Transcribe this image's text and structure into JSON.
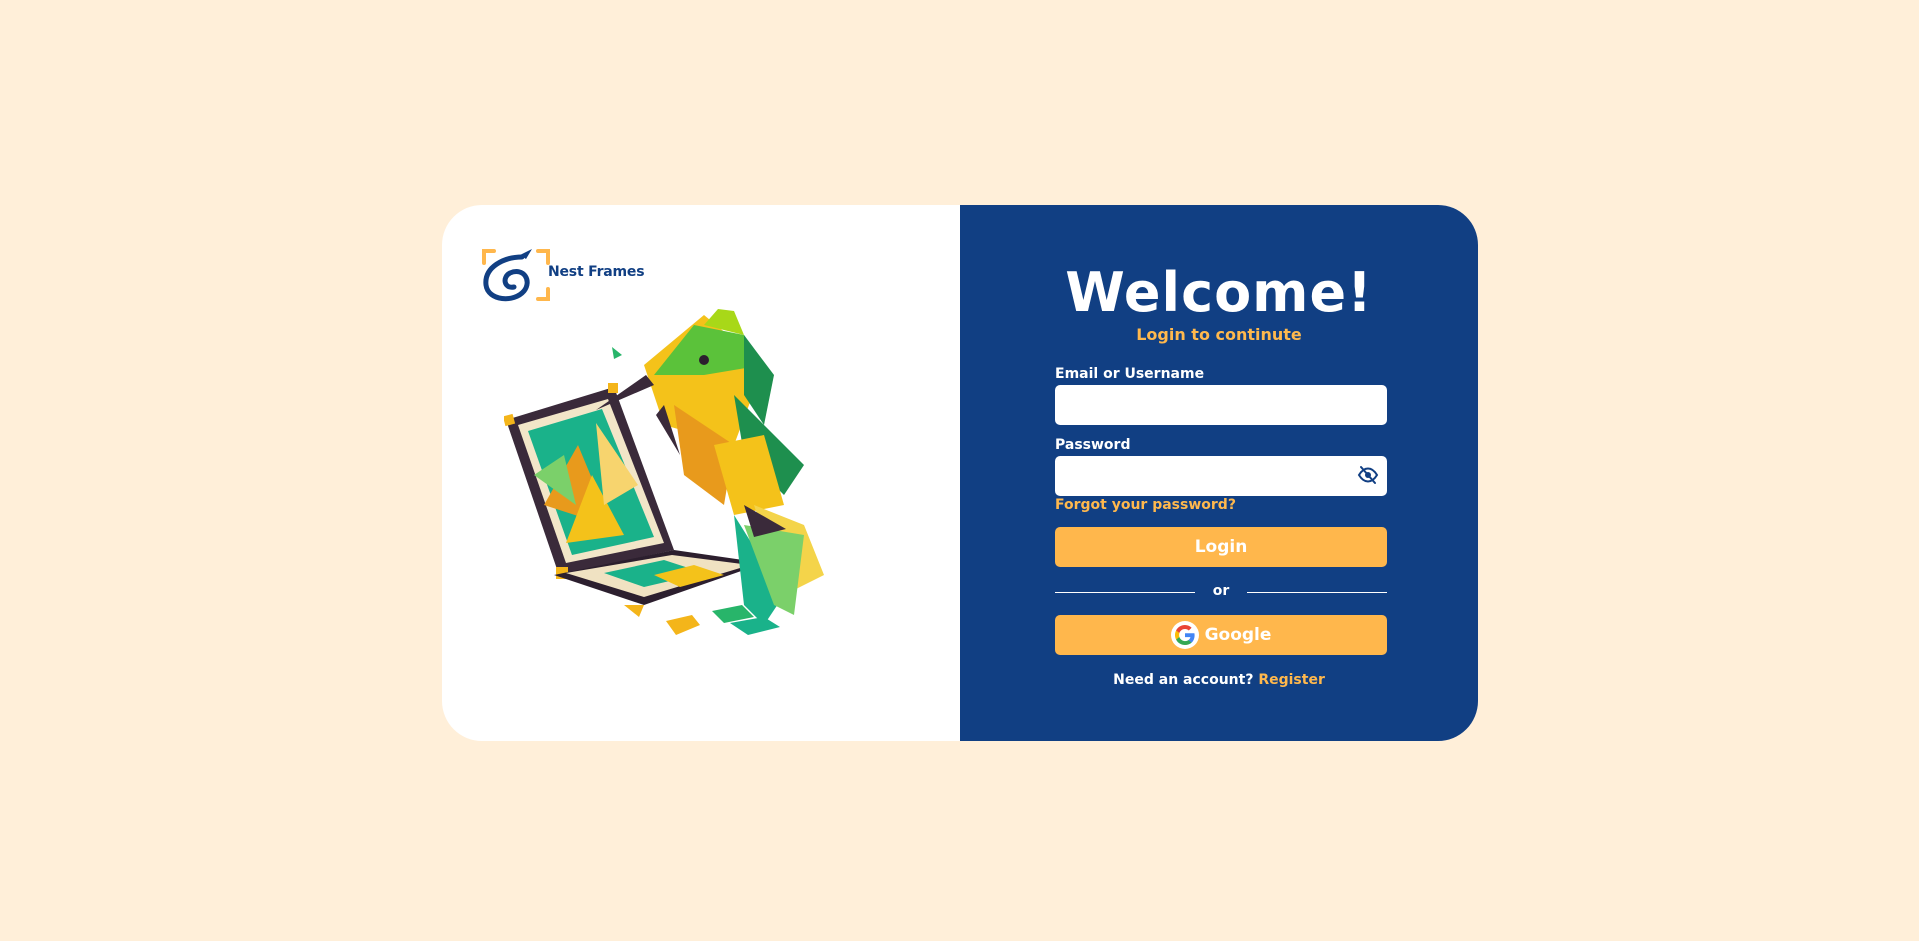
{
  "brand": {
    "name": "Nest Frames"
  },
  "hero": {
    "title": "Welcome!",
    "subtitle": "Login to continute"
  },
  "form": {
    "email_label": "Email or Username",
    "email_value": "",
    "password_label": "Password",
    "password_value": "",
    "forgot_link": "Forgot your password?",
    "login_button": "Login",
    "divider_text": "or",
    "google_button": "Google",
    "need_account_text": "Need an account?",
    "register_link": "Register"
  },
  "icons": {
    "password_toggle": "eye-off-icon",
    "google": "google-icon",
    "logo": "nest-frames-logo"
  },
  "colors": {
    "page_bg": "#FFEFD9",
    "panel_bg": "#113F83",
    "accent": "#FFB74C",
    "card_bg": "#FFFFFF"
  }
}
